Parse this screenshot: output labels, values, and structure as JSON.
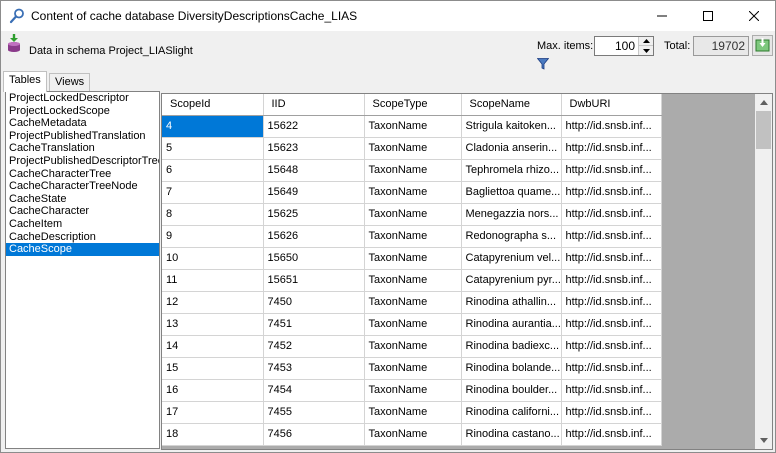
{
  "window": {
    "title": "Content of cache database DiversityDescriptionsCache_LIAS",
    "icon": "magnifier-key-icon"
  },
  "toolbar": {
    "schema_text": "Data in schema Project_LIASlight",
    "max_items_label": "Max. items:",
    "max_items_value": "100",
    "total_label": "Total:",
    "total_value": "19702"
  },
  "tabs": [
    {
      "label": "Tables",
      "active": true
    },
    {
      "label": "Views",
      "active": false
    }
  ],
  "tables_list": [
    "ProjectLockedDescriptor",
    "ProjectLockedScope",
    "CacheMetadata",
    "ProjectPublishedTranslation",
    "CacheTranslation",
    "ProjectPublishedDescriptorTree",
    "CacheCharacterTree",
    "CacheCharacterTreeNode",
    "CacheState",
    "CacheCharacter",
    "CacheItem",
    "CacheDescription",
    "CacheScope"
  ],
  "selected_table": "CacheScope",
  "grid": {
    "columns": [
      "ScopeId",
      "IID",
      "ScopeType",
      "ScopeName",
      "DwbURI"
    ],
    "rows": [
      [
        "4",
        "15622",
        "TaxonName",
        "Strigula kaitoken...",
        "http://id.snsb.inf..."
      ],
      [
        "5",
        "15623",
        "TaxonName",
        "Cladonia anserin...",
        "http://id.snsb.inf..."
      ],
      [
        "6",
        "15648",
        "TaxonName",
        "Tephromela rhizo...",
        "http://id.snsb.inf..."
      ],
      [
        "7",
        "15649",
        "TaxonName",
        "Bagliettoa quame...",
        "http://id.snsb.inf..."
      ],
      [
        "8",
        "15625",
        "TaxonName",
        "Menegazzia nors...",
        "http://id.snsb.inf..."
      ],
      [
        "9",
        "15626",
        "TaxonName",
        "Redonographa s...",
        "http://id.snsb.inf..."
      ],
      [
        "10",
        "15650",
        "TaxonName",
        "Catapyrenium vel...",
        "http://id.snsb.inf..."
      ],
      [
        "11",
        "15651",
        "TaxonName",
        "Catapyrenium pyr...",
        "http://id.snsb.inf..."
      ],
      [
        "12",
        "7450",
        "TaxonName",
        "Rinodina athallin...",
        "http://id.snsb.inf..."
      ],
      [
        "13",
        "7451",
        "TaxonName",
        "Rinodina aurantia...",
        "http://id.snsb.inf..."
      ],
      [
        "14",
        "7452",
        "TaxonName",
        "Rinodina badiexc...",
        "http://id.snsb.inf..."
      ],
      [
        "15",
        "7453",
        "TaxonName",
        "Rinodina bolande...",
        "http://id.snsb.inf..."
      ],
      [
        "16",
        "7454",
        "TaxonName",
        "Rinodina boulder...",
        "http://id.snsb.inf..."
      ],
      [
        "17",
        "7455",
        "TaxonName",
        "Rinodina californi...",
        "http://id.snsb.inf..."
      ],
      [
        "18",
        "7456",
        "TaxonName",
        "Rinodina castano...",
        "http://id.snsb.inf..."
      ]
    ]
  },
  "colors": {
    "selection": "#0078d7",
    "grid_background": "#ababab"
  }
}
